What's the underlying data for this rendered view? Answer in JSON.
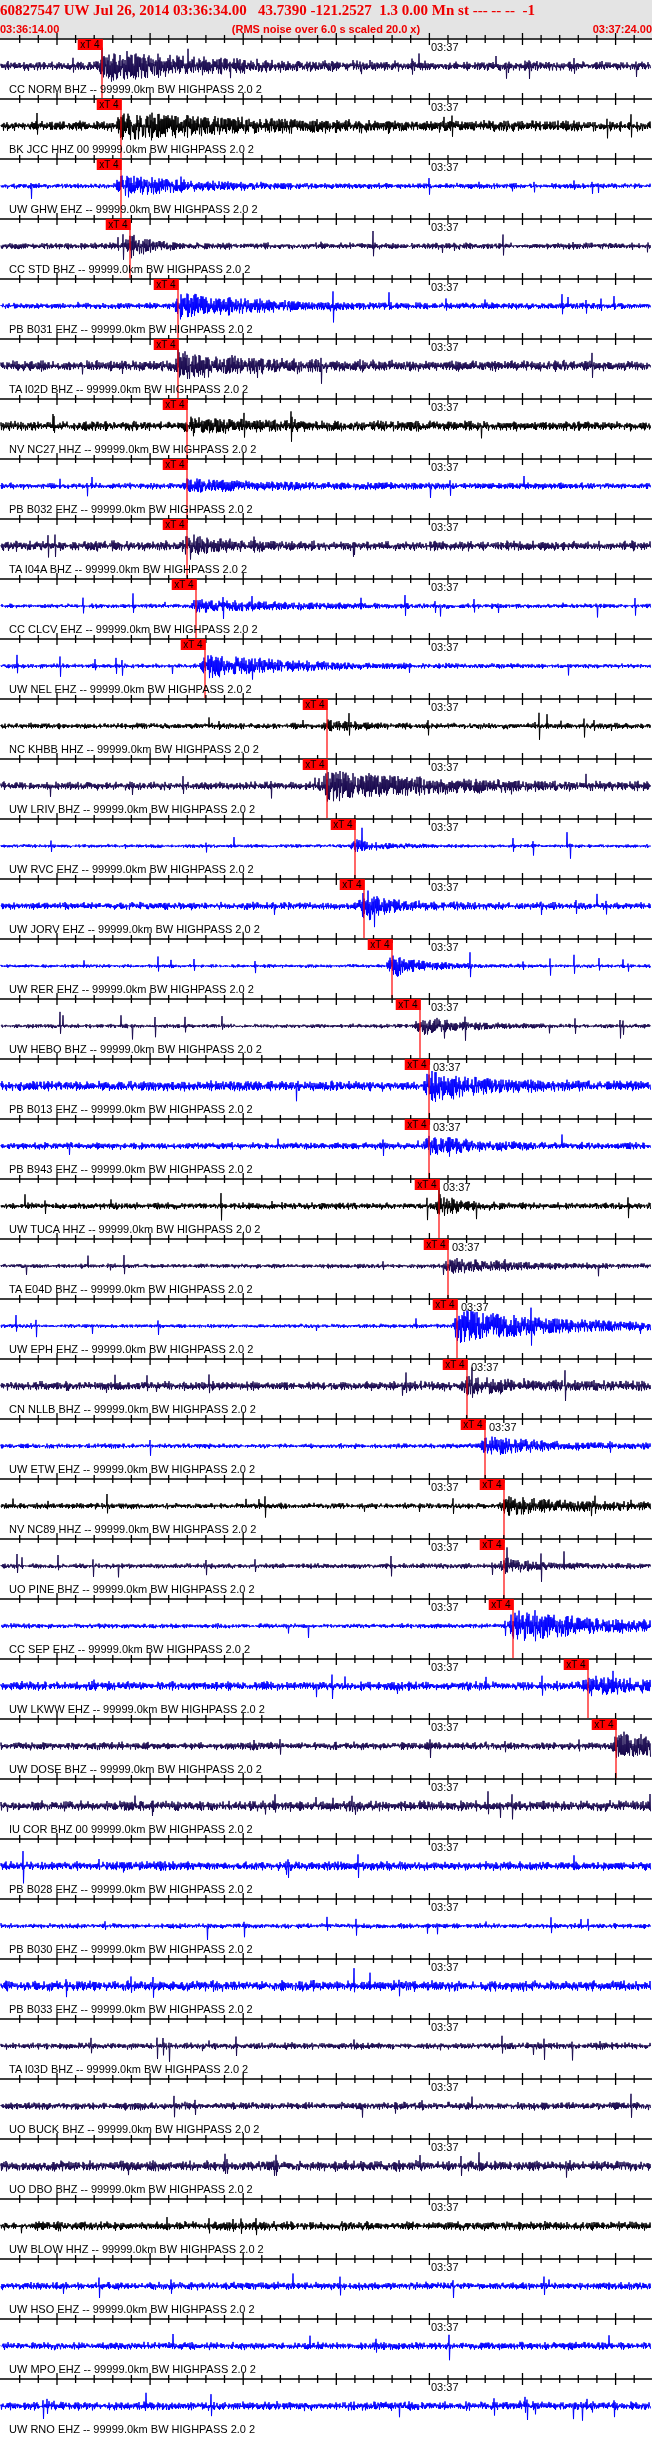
{
  "header": {
    "title": "60827547 UW Jul 26, 2014 03:36:34.00   43.7390 -121.2527  1.3 0.00 Mn st --- -- --  -1",
    "start_time": "03:36:14.00",
    "note": "(RMS noise over 6.0 s scaled 20.0 x)",
    "end_time": "03:37:24.00"
  },
  "traces": [
    {
      "label": "CC NORM BHZ -- 99999.0km BW HIGHPASS 2.0 2",
      "time_mark": "03:37",
      "color": "#1a0a50",
      "pick": {
        "label": "xT 4"
      }
    },
    {
      "label": "BK JCC HHZ 00 99999.0km BW HIGHPASS 2.0 2",
      "time_mark": "03:37",
      "color": "#000000",
      "pick": {
        "label": "xT 4"
      }
    },
    {
      "label": "UW GHW EHZ -- 99999.0km BW HIGHPASS 2.0 2",
      "time_mark": "03:37",
      "color": "#0000ff",
      "pick": {
        "label": "xT 4"
      }
    },
    {
      "label": "CC STD BHZ -- 99999.0km BW HIGHPASS 2.0 2",
      "time_mark": "03:37",
      "color": "#1a0a50",
      "pick": {
        "label": "xT 4"
      }
    },
    {
      "label": "PB B031 EHZ -- 99999.0km BW HIGHPASS 2.0 2",
      "time_mark": "03:37",
      "color": "#0000ff",
      "pick": {
        "label": "xT 4"
      }
    },
    {
      "label": "TA I02D BHZ -- 99999.0km BW HIGHPASS 2.0 2",
      "time_mark": "03:37",
      "color": "#1a0a50",
      "pick": {
        "label": "xT 4"
      }
    },
    {
      "label": "NV NC27 HHZ -- 99999.0km BW HIGHPASS 2.0 2",
      "time_mark": "03:37",
      "color": "#000000",
      "pick": {
        "label": "xT 4"
      }
    },
    {
      "label": "PB B032 EHZ -- 99999.0km BW HIGHPASS 2.0 2",
      "time_mark": "03:37",
      "color": "#0000ff",
      "pick": {
        "label": "xT 4"
      }
    },
    {
      "label": "TA I04A BHZ -- 99999.0km BW HIGHPASS 2.0 2",
      "time_mark": "03:37",
      "color": "#1a0a50",
      "pick": {
        "label": "xT 4"
      }
    },
    {
      "label": "CC CLCV EHZ -- 99999.0km BW HIGHPASS 2.0 2",
      "time_mark": "03:37",
      "color": "#0000ff",
      "pick": {
        "label": "xT 4"
      }
    },
    {
      "label": "UW NEL EHZ -- 99999.0km BW HIGHPASS 2.0 2",
      "time_mark": "03:37",
      "color": "#0000ff",
      "pick": {
        "label": "xT 4"
      }
    },
    {
      "label": "NC KHBB HHZ -- 99999.0km BW HIGHPASS 2.0 2",
      "time_mark": "03:37",
      "color": "#000000",
      "pick": {
        "label": "xT 4"
      }
    },
    {
      "label": "UW LRIV BHZ -- 99999.0km BW HIGHPASS 2.0 2",
      "time_mark": "03:37",
      "color": "#1a0a50",
      "pick": {
        "label": "xT 4"
      }
    },
    {
      "label": "UW RVC EHZ -- 99999.0km BW HIGHPASS 2.0 2",
      "time_mark": "03:37",
      "color": "#0000ff",
      "pick": {
        "label": "xT 4"
      }
    },
    {
      "label": "UW JORV EHZ -- 99999.0km BW HIGHPASS 2.0 2",
      "time_mark": "03:37",
      "color": "#0000ff",
      "pick": {
        "label": "xT 4"
      }
    },
    {
      "label": "UW RER EHZ -- 99999.0km BW HIGHPASS 2.0 2",
      "time_mark": "03:37",
      "color": "#0000ff",
      "pick": {
        "label": "xT 4"
      }
    },
    {
      "label": "UW HEBO BHZ -- 99999.0km BW HIGHPASS 2.0 2",
      "time_mark": "03:37",
      "color": "#1a0a50",
      "pick": {
        "label": "xT 4"
      }
    },
    {
      "label": "PB B013 EHZ -- 99999.0km BW HIGHPASS 2.0 2",
      "time_mark": "03:37",
      "color": "#0000ff",
      "pick": {
        "label": "xT 4"
      }
    },
    {
      "label": "PB B943 EHZ -- 99999.0km BW HIGHPASS 2.0 2",
      "time_mark": "03:37",
      "color": "#0000ff",
      "pick": {
        "label": "xT 4"
      }
    },
    {
      "label": "UW TUCA HHZ -- 99999.0km BW HIGHPASS 2.0 2",
      "time_mark": "03:37",
      "color": "#000000",
      "pick": {
        "label": "xT 4"
      }
    },
    {
      "label": "TA E04D BHZ -- 99999.0km BW HIGHPASS 2.0 2",
      "time_mark": "03:37",
      "color": "#1a0a50",
      "pick": {
        "label": "xT 4"
      }
    },
    {
      "label": "UW EPH EHZ -- 99999.0km BW HIGHPASS 2.0 2",
      "time_mark": "03:37",
      "color": "#0000ff",
      "pick": {
        "label": "xT 4"
      }
    },
    {
      "label": "CN NLLB BHZ -- 99999.0km BW HIGHPASS 2.0 2",
      "time_mark": "03:37",
      "color": "#1a0a50",
      "pick": {
        "label": "xT 4"
      }
    },
    {
      "label": "UW ETW EHZ -- 99999.0km BW HIGHPASS 2.0 2",
      "time_mark": "03:37",
      "color": "#0000ff",
      "pick": {
        "label": "xT 4"
      }
    },
    {
      "label": "NV NC89 HHZ -- 99999.0km BW HIGHPASS 2.0 2",
      "time_mark": "03:37",
      "color": "#000000",
      "pick": {
        "label": "xT 4"
      }
    },
    {
      "label": "UO PINE BHZ -- 99999.0km BW HIGHPASS 2.0 2",
      "time_mark": "03:37",
      "color": "#1a0a50",
      "pick": {
        "label": "xT 4"
      }
    },
    {
      "label": "CC SEP EHZ -- 99999.0km BW HIGHPASS 2.0 2",
      "time_mark": "03:37",
      "color": "#0000ff",
      "pick": {
        "label": "xT 4"
      }
    },
    {
      "label": "UW LKWW EHZ -- 99999.0km BW HIGHPASS 2.0 2",
      "time_mark": "03:37",
      "color": "#0000ff",
      "pick": {
        "label": "xT 4"
      }
    },
    {
      "label": "UW DOSE BHZ -- 99999.0km BW HIGHPASS 2.0 2",
      "time_mark": "03:37",
      "color": "#1a0a50",
      "pick": {
        "label": "xT 4"
      }
    },
    {
      "label": "IU COR BHZ 00 99999.0km BW HIGHPASS 2.0 2",
      "time_mark": "03:37",
      "color": "#1a0a50"
    },
    {
      "label": "PB B028 EHZ -- 99999.0km BW HIGHPASS 2.0 2",
      "time_mark": "03:37",
      "color": "#0000ff"
    },
    {
      "label": "PB B030 EHZ -- 99999.0km BW HIGHPASS 2.0 2",
      "time_mark": "03:37",
      "color": "#0000ff"
    },
    {
      "label": "PB B033 EHZ -- 99999.0km BW HIGHPASS 2.0 2",
      "time_mark": "03:37",
      "color": "#0000ff"
    },
    {
      "label": "TA I03D BHZ -- 99999.0km BW HIGHPASS 2.0 2",
      "time_mark": "03:37",
      "color": "#1a0a50"
    },
    {
      "label": "UO BUCK BHZ -- 99999.0km BW HIGHPASS 2.0 2",
      "time_mark": "03:37",
      "color": "#1a0a50"
    },
    {
      "label": "UO DBO BHZ -- 99999.0km BW HIGHPASS 2.0 2",
      "time_mark": "03:37",
      "color": "#1a0a50"
    },
    {
      "label": "UW BLOW HHZ -- 99999.0km BW HIGHPASS 2.0 2",
      "time_mark": "03:37",
      "color": "#000000"
    },
    {
      "label": "UW HSO EHZ -- 99999.0km BW HIGHPASS 2.0 2",
      "time_mark": "03:37",
      "color": "#0000ff"
    },
    {
      "label": "UW MPO EHZ -- 99999.0km BW HIGHPASS 2.0 2",
      "time_mark": "03:37",
      "color": "#0000ff"
    },
    {
      "label": "UW RNO EHZ -- 99999.0km BW HIGHPASS 2.0 2",
      "time_mark": "03:37",
      "color": "#0000ff"
    }
  ]
}
